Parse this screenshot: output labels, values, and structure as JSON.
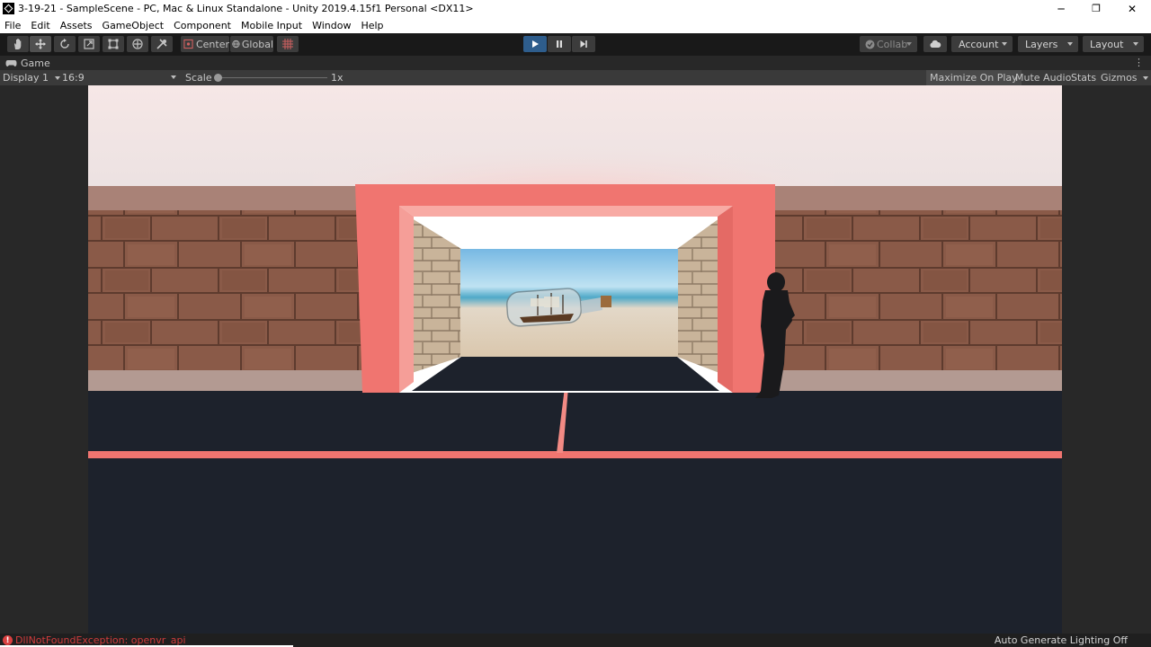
{
  "window": {
    "title": "3-19-21 - SampleScene - PC, Mac & Linux Standalone - Unity 2019.4.15f1 Personal <DX11>",
    "minimize": "─",
    "restore": "❐",
    "close": "✕"
  },
  "menu": [
    "File",
    "Edit",
    "Assets",
    "GameObject",
    "Component",
    "Mobile Input",
    "Window",
    "Help"
  ],
  "toolbar": {
    "pivot_mode": "Center",
    "pivot_rotation": "Global",
    "collab": "Collab",
    "account": "Account",
    "layers": "Layers",
    "layout": "Layout"
  },
  "game_tab": {
    "label": "Game",
    "display": "Display 1",
    "aspect": "16:9",
    "scale_label": "Scale",
    "scale_value": "1x",
    "maximize": "Maximize On Play",
    "mute": "Mute Audio",
    "stats": "Stats",
    "gizmos": "Gizmos"
  },
  "status": {
    "error": "DllNotFoundException: openvr_api",
    "lighting": "Auto Generate Lighting Off"
  },
  "colors": {
    "accent_play": "#2e5d8c",
    "error": "#d03c3c",
    "frame": "#f07570",
    "road": "#1d222c"
  }
}
